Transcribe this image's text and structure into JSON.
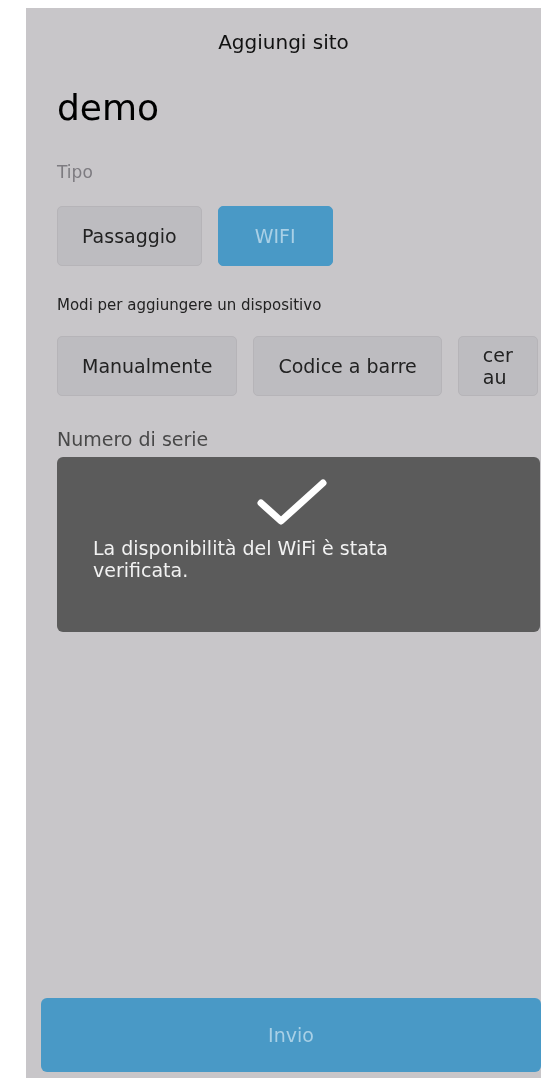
{
  "header": {
    "title": "Aggiungi sito"
  },
  "site_name": "demo",
  "type_section": {
    "label": "Tipo",
    "options": [
      {
        "label": "Passaggio",
        "selected": false
      },
      {
        "label": "WIFI",
        "selected": true
      }
    ]
  },
  "methods_section": {
    "label": "Modi per aggiungere un dispositivo",
    "options": [
      {
        "lines": [
          "Manualmente"
        ]
      },
      {
        "lines": [
          "Codice a barre"
        ]
      },
      {
        "lines": [
          "cer",
          "au"
        ]
      }
    ]
  },
  "serial_label": "Numero di serie",
  "toast": {
    "message": "La disponibilità del WiFi è stata verificata."
  },
  "submit_button": "Invio"
}
